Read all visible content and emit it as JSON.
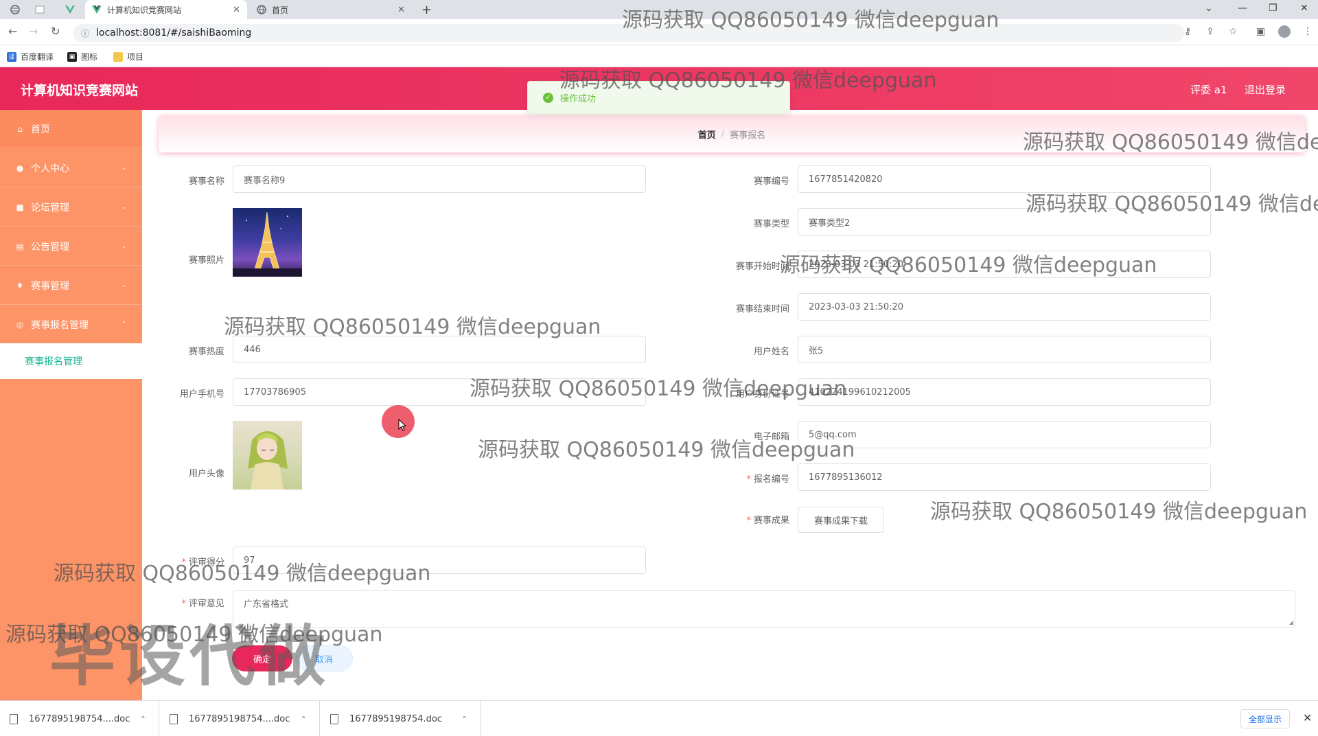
{
  "browser": {
    "tabs": [
      {
        "title": "计算机知识竞赛网站",
        "active": true
      },
      {
        "title": "首页",
        "active": false
      }
    ],
    "new_tab": "+",
    "url": "localhost:8081/#/saishiBaoming",
    "bookmarks": [
      "百度翻译",
      "图标",
      "项目"
    ]
  },
  "header": {
    "site_title": "计算机知识竞赛网站",
    "user": "评委 a1",
    "logout": "退出登录",
    "background_color": "#e8285a"
  },
  "toast": {
    "message": "操作成功",
    "color": "#67c23a"
  },
  "sidebar": {
    "background_color": "#fd9468",
    "items": [
      {
        "label": "首页",
        "icon": "home-icon"
      },
      {
        "label": "个人中心",
        "icon": "user-icon"
      },
      {
        "label": "论坛管理",
        "icon": "forum-icon"
      },
      {
        "label": "公告管理",
        "icon": "notice-icon"
      },
      {
        "label": "赛事管理",
        "icon": "event-icon"
      },
      {
        "label": "赛事报名管理",
        "icon": "signup-icon"
      }
    ],
    "submenu_active": "赛事报名管理"
  },
  "breadcrumb": {
    "home": "首页",
    "separator": "/",
    "current": "赛事报名"
  },
  "form": {
    "event_name": {
      "label": "赛事名称",
      "value": "赛事名称9"
    },
    "event_code": {
      "label": "赛事编号",
      "value": "1677851420820"
    },
    "event_photo": {
      "label": "赛事照片"
    },
    "event_type": {
      "label": "赛事类型",
      "value": "赛事类型2"
    },
    "start_time": {
      "label": "赛事开始时间",
      "value": "2023-03-03 21:50:20"
    },
    "end_time": {
      "label": "赛事结束时间",
      "value": "2023-03-03 21:50:20"
    },
    "event_heat": {
      "label": "赛事热度",
      "value": "446"
    },
    "user_name": {
      "label": "用户姓名",
      "value": "张5"
    },
    "user_phone": {
      "label": "用户手机号",
      "value": "17703786905"
    },
    "user_id_card": {
      "label": "用户身份证号",
      "value": "410224199610212005"
    },
    "user_email": {
      "label": "电子邮箱",
      "value": "5@qq.com"
    },
    "user_avatar": {
      "label": "用户头像"
    },
    "signup_code": {
      "label": "报名编号",
      "value": "1677895136012"
    },
    "result": {
      "label": "赛事成果",
      "button": "赛事成果下载"
    },
    "score": {
      "label": "评审得分",
      "value": "97"
    },
    "opinion": {
      "label": "评审意见",
      "value": "广东省格式"
    },
    "required_mark": "*",
    "confirm": "确定",
    "cancel": "取消"
  },
  "downloads": {
    "items": [
      "1677895198754....doc",
      "1677895198754....doc",
      "1677895198754.doc"
    ],
    "show_all": "全部显示"
  },
  "watermark": {
    "text": "源码获取 QQ86050149 微信deepguan",
    "big_text": "毕设代做"
  }
}
